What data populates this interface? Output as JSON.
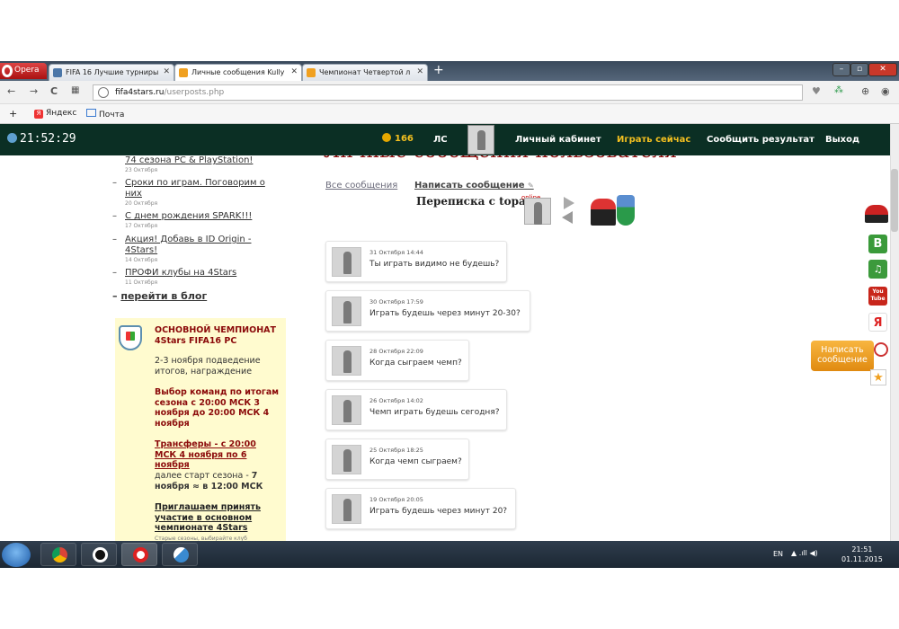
{
  "browser": {
    "opera_label": "Opera",
    "tabs": [
      {
        "label": "FIFA 16 Лучшие турниры",
        "icon_color": "#4a76a8"
      },
      {
        "label": "Личные сообщения Kully",
        "icon_color": "#f0a020"
      },
      {
        "label": "Чемпионат Четвертой л",
        "icon_color": "#f0a020"
      }
    ],
    "url_domain": "fifa4stars.ru",
    "url_path": "/userposts.php",
    "bookmarks": [
      {
        "label": "Яндекс"
      },
      {
        "label": "Почта"
      }
    ]
  },
  "header": {
    "clock": "21:52:29",
    "coins": "166",
    "nav": {
      "ls": "ЛС",
      "cabinet": "Личный кабинет",
      "play_now": "Играть сейчас",
      "report": "Сообщить результат",
      "logout": "Выход"
    },
    "play_now_color": "#f4c020"
  },
  "blog": {
    "items": [
      {
        "title": "74 сезона PC & PlayStation!",
        "date": "23 Октября"
      },
      {
        "title": "Сроки по играм. Поговорим о них",
        "date": "20 Октября"
      },
      {
        "title": "С днем рождения SPARK!!!",
        "date": "17 Октября"
      },
      {
        "title": "Акция! Добавь в ID Origin - 4Stars!",
        "date": "14 Октября"
      },
      {
        "title": "ПРОФИ клубы на 4Stars",
        "date": "11 Октября"
      }
    ],
    "more_label": "перейти в блог"
  },
  "championship": {
    "title": "ОСНОВНОЙ ЧЕМПИОНАТ 4Stars FIFA16 PC",
    "line1": "2-3 ноября подведение итогов, награждение",
    "line2": "Выбор команд по итогам сезона с 20:00 МСК 3 ноября до 20:00 МСК 4 ноября",
    "line3": "Трансферы - с 20:00 МСК 4 ноября по 6 ноября",
    "line4_prefix": "далее старт сезона - ",
    "line4_bold": "7 ноября ≈ в 12:00 МСК",
    "line5": "Приглашаем принять участие в основном чемпионате 4Stars",
    "line6": "Старые сезоны, выбирайте клуб"
  },
  "messages_page": {
    "heading": "Личные сообщения пользователя",
    "tab_all": "Все сообщения",
    "tab_write": "Написать сообщение",
    "correspondence": "Переписка с topa",
    "online": "online"
  },
  "messages": [
    {
      "date": "31 Октября 14:44",
      "text": "Ты играть видимо не будешь?"
    },
    {
      "date": "30 Октября 17:59",
      "text": "Играть будешь через минут 20-30?"
    },
    {
      "date": "28 Октября 22:09",
      "text": "Когда сыграем чемп?"
    },
    {
      "date": "26 Октября 14:02",
      "text": "Чемп играть будешь сегодня?"
    },
    {
      "date": "25 Октября 18:25",
      "text": "Когда чемп сыграем?"
    },
    {
      "date": "19 Октября 20:05",
      "text": "Играть будешь через минут 20?"
    }
  ],
  "social": {
    "vk": "B",
    "yandex": "Я",
    "youtube": "You Tube",
    "write_button": "Написать сообщение"
  },
  "taskbar": {
    "lang": "EN",
    "time": "21:51",
    "date": "01.11.2015"
  }
}
